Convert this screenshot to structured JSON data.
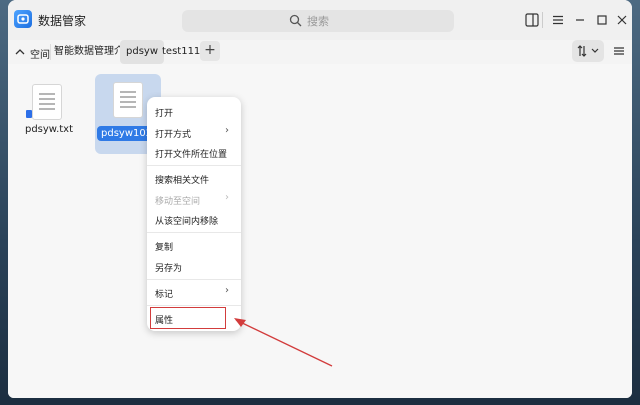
{
  "window": {
    "title": "数据管家"
  },
  "search": {
    "placeholder": "搜索"
  },
  "nav": {
    "space_label": "空间",
    "tabs": [
      {
        "label": "智能数据管理介绍",
        "active": false
      },
      {
        "label": "pdsyw",
        "active": true
      },
      {
        "label": "test111",
        "active": false
      }
    ]
  },
  "files": [
    {
      "name": "pdsyw.txt",
      "selected": false
    },
    {
      "name": "pdsyw1024.txt",
      "selected": true
    }
  ],
  "context_menu": {
    "items": [
      {
        "label": "打开",
        "disabled": false,
        "has_submenu": false
      },
      {
        "label": "打开方式",
        "disabled": false,
        "has_submenu": true
      },
      {
        "label": "打开文件所在位置",
        "disabled": false,
        "has_submenu": false
      },
      {
        "label": "搜索相关文件",
        "disabled": false,
        "has_submenu": false
      },
      {
        "label": "移动至空间",
        "disabled": true,
        "has_submenu": true
      },
      {
        "label": "从该空间内移除",
        "disabled": false,
        "has_submenu": false
      },
      {
        "label": "复制",
        "disabled": false,
        "has_submenu": false
      },
      {
        "label": "另存为",
        "disabled": false,
        "has_submenu": false
      },
      {
        "label": "标记",
        "disabled": false,
        "has_submenu": true
      },
      {
        "label": "属性",
        "disabled": false,
        "has_submenu": false
      }
    ]
  },
  "colors": {
    "accent": "#2f7ae6",
    "annotation": "#d23c3c"
  }
}
